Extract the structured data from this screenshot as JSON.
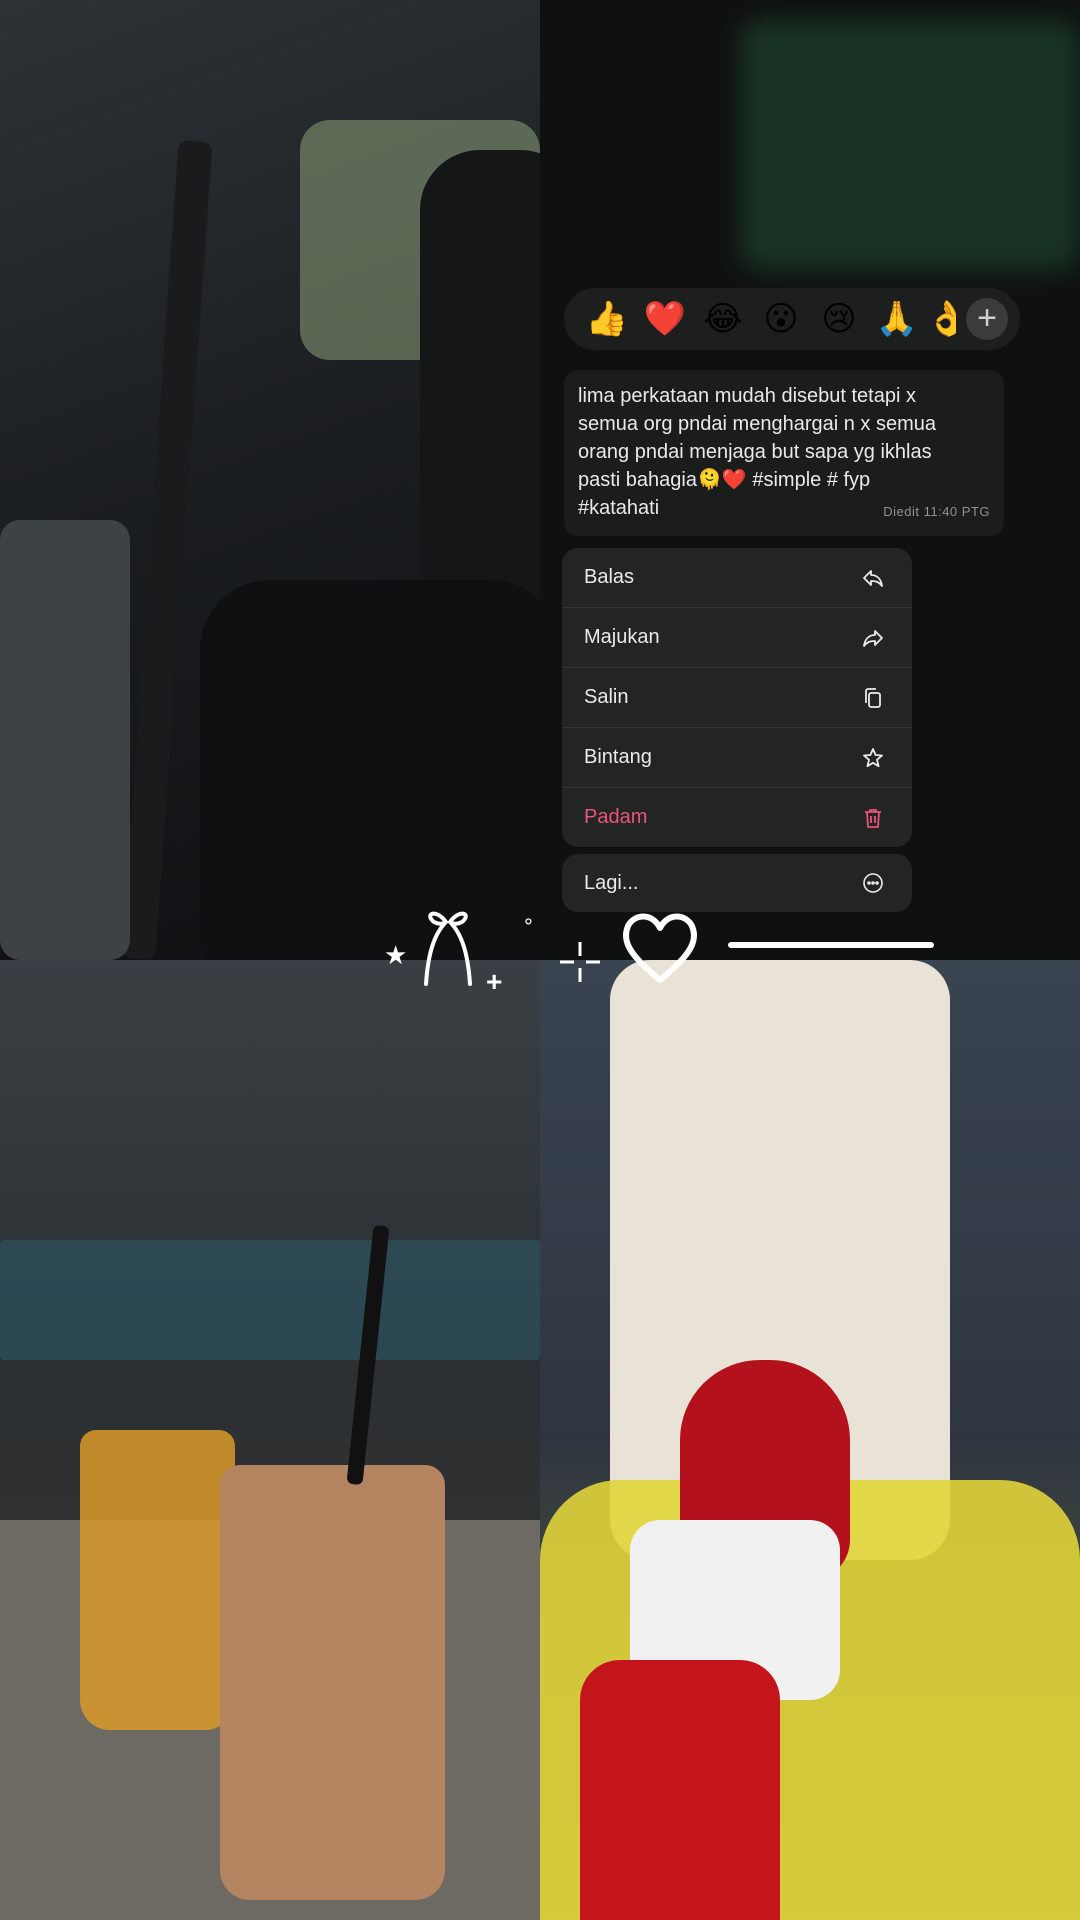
{
  "reactions": {
    "emojis": [
      "👍",
      "❤️",
      "😂",
      "😮",
      "😢",
      "🙏",
      "👌"
    ],
    "add_label": "+"
  },
  "message": {
    "text": "lima perkataan mudah disebut tetapi x\nsemua org pndai menghargai n x semua\norang pndai menjaga but sapa yg ikhlas\npasti bahagia🫠❤️ #simple # fyp\n#katahati",
    "status": "Diedit",
    "time": "11:40 PTG"
  },
  "menu": {
    "reply_label": "Balas",
    "forward_label": "Majukan",
    "copy_label": "Salin",
    "star_label": "Bintang",
    "delete_label": "Padam",
    "more_label": "Lagi..."
  },
  "colors": {
    "danger": "#e8547a",
    "menu_bg": "#232524",
    "bubble_bg": "#1b1d1c"
  },
  "icons": [
    "reply-icon",
    "forward-icon",
    "copy-icon",
    "star-icon",
    "trash-icon",
    "more-icon",
    "plus-icon"
  ]
}
